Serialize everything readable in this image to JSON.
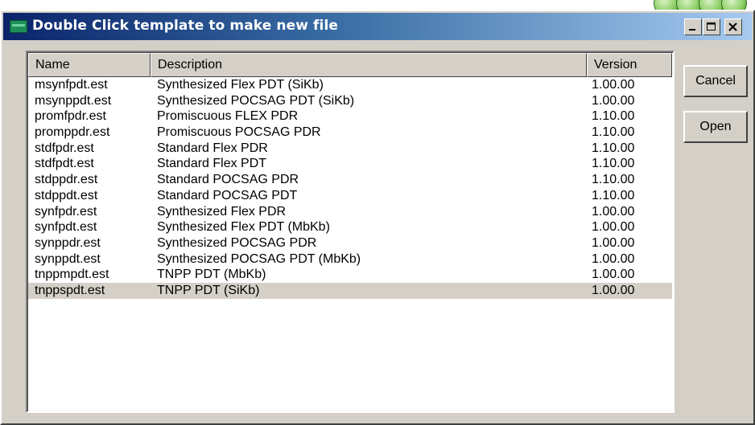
{
  "window": {
    "title": "Double Click template to make new file",
    "caption_buttons": {
      "minimize": "minimize-icon",
      "maximize": "maximize-icon",
      "close": "close-icon"
    }
  },
  "listview": {
    "columns": {
      "name": "Name",
      "description": "Description",
      "version": "Version"
    },
    "rows": [
      {
        "name": "msynfpdt.est",
        "description": "Synthesized Flex PDT (SiKb)",
        "version": "1.00.00"
      },
      {
        "name": "msynppdt.est",
        "description": "Synthesized POCSAG PDT (SiKb)",
        "version": "1.00.00"
      },
      {
        "name": "promfpdr.est",
        "description": "Promiscuous FLEX PDR",
        "version": "1.10.00"
      },
      {
        "name": "promppdr.est",
        "description": "Promiscuous POCSAG PDR",
        "version": "1.10.00"
      },
      {
        "name": "stdfpdr.est",
        "description": "Standard Flex PDR",
        "version": "1.10.00"
      },
      {
        "name": "stdfpdt.est",
        "description": "Standard Flex PDT",
        "version": "1.10.00"
      },
      {
        "name": "stdppdr.est",
        "description": "Standard POCSAG PDR",
        "version": "1.10.00"
      },
      {
        "name": "stdppdt.est",
        "description": "Standard POCSAG PDT",
        "version": "1.10.00"
      },
      {
        "name": "synfpdr.est",
        "description": "Synthesized Flex PDR",
        "version": "1.00.00"
      },
      {
        "name": "synfpdt.est",
        "description": "Synthesized Flex PDT (MbKb)",
        "version": "1.00.00"
      },
      {
        "name": "synppdr.est",
        "description": "Synthesized POCSAG PDR",
        "version": "1.00.00"
      },
      {
        "name": "synppdt.est",
        "description": "Synthesized POCSAG PDT (MbKb)",
        "version": "1.00.00"
      },
      {
        "name": "tnppmpdt.est",
        "description": "TNPP PDT (MbKb)",
        "version": "1.00.00"
      },
      {
        "name": "tnppspdt.est",
        "description": "TNPP PDT (SiKb)",
        "version": "1.00.00"
      }
    ],
    "selected_index": 13
  },
  "buttons": {
    "cancel": "Cancel",
    "open": "Open"
  },
  "colors": {
    "titlebar_start": "#0a246a",
    "titlebar_end": "#a6caf0",
    "face": "#d4d0c8",
    "selected_row": "#d4d0c8"
  }
}
